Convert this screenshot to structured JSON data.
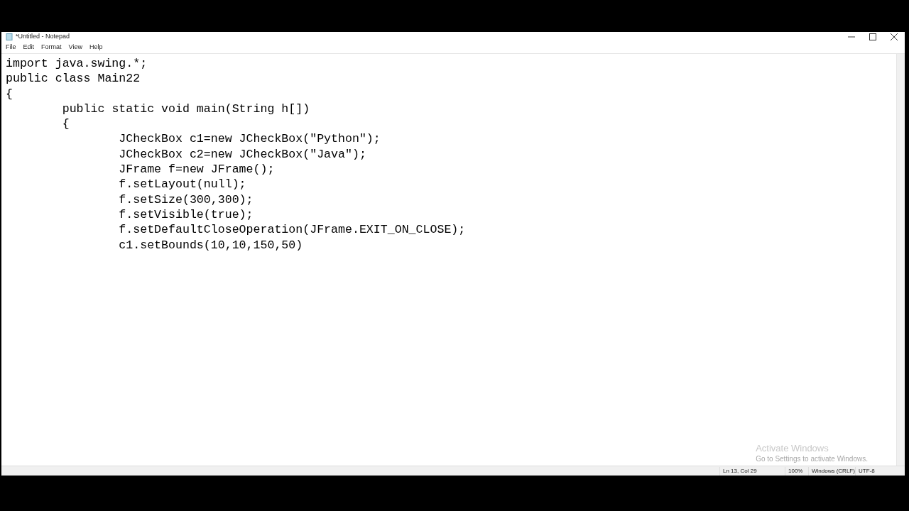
{
  "window": {
    "title": "*Untitled - Notepad",
    "controls": [
      {
        "kind": "minimize"
      },
      {
        "kind": "maximize"
      },
      {
        "kind": "close"
      }
    ]
  },
  "menu": [
    "File",
    "Edit",
    "Format",
    "View",
    "Help"
  ],
  "editor": {
    "lines": [
      "import java.swing.*;",
      "public class Main22",
      "{",
      "\tpublic static void main(String h[])",
      "\t{",
      "\t\tJCheckBox c1=new JCheckBox(\"Python\");",
      "\t\tJCheckBox c2=new JCheckBox(\"Java\");",
      "\t\tJFrame f=new JFrame();",
      "\t\tf.setLayout(null);",
      "\t\tf.setSize(300,300);",
      "\t\tf.setVisible(true);",
      "\t\tf.setDefaultCloseOperation(JFrame.EXIT_ON_CLOSE);",
      "\t\tc1.setBounds(10,10,150,50)"
    ]
  },
  "activation_notice": {
    "title": "Activate Windows",
    "subtitle": "Go to Settings to activate Windows."
  },
  "status_bar": [
    "Ln 13, Col 29",
    "100%",
    "Windows (CRLF)",
    "UTF-8"
  ]
}
